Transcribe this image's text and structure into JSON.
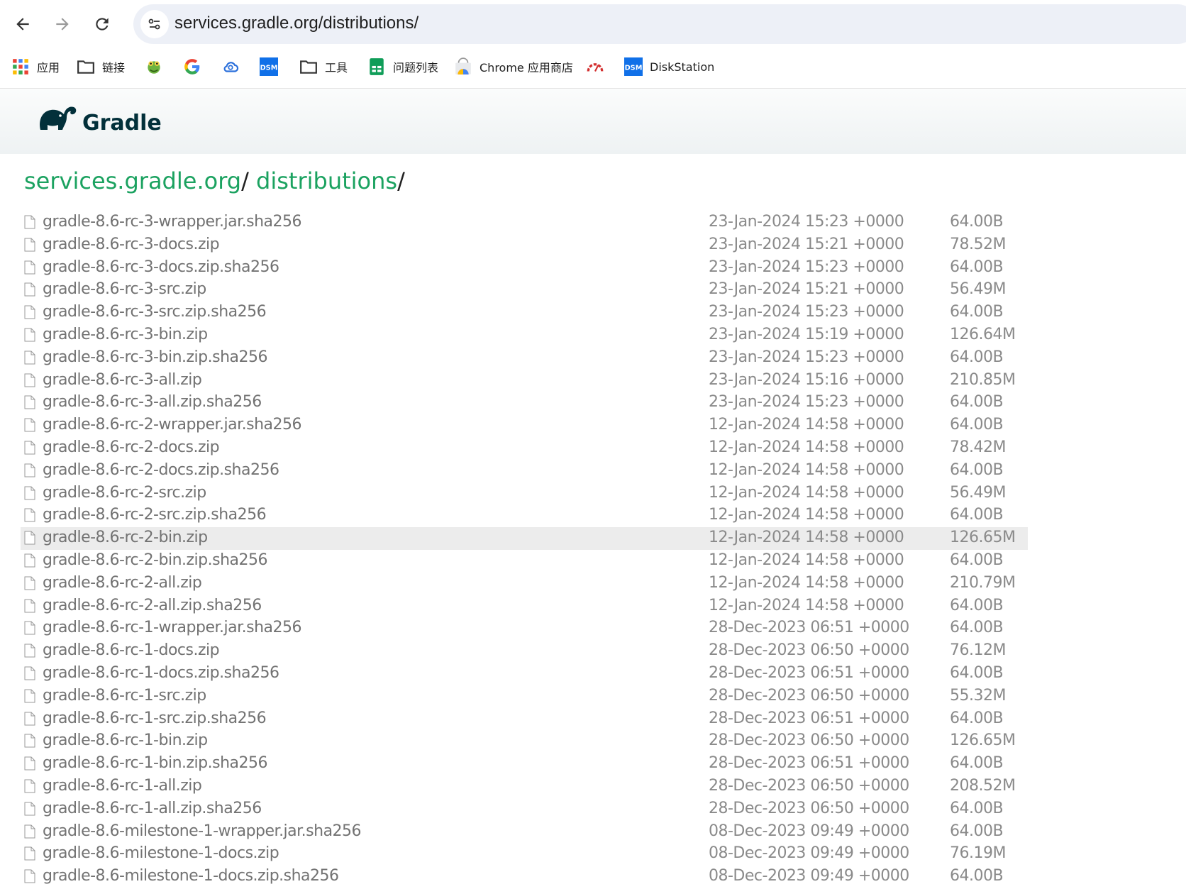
{
  "browser": {
    "url": "services.gradle.org/distributions/",
    "bookmarks": [
      {
        "label": "应用",
        "icon": "apps-grid-icon"
      },
      {
        "label": "链接",
        "icon": "folder-icon"
      },
      {
        "label": "",
        "icon": "frog-icon"
      },
      {
        "label": "",
        "icon": "google-icon"
      },
      {
        "label": "",
        "icon": "cloud-icon"
      },
      {
        "label": "",
        "icon": "dsm-icon"
      },
      {
        "label": "工具",
        "icon": "folder-icon"
      },
      {
        "label": "问题列表",
        "icon": "sheets-icon"
      },
      {
        "label": "Chrome 应用商店",
        "icon": "chrome-webstore-icon"
      },
      {
        "label": "",
        "icon": "speedometer-icon"
      },
      {
        "label": "DiskStation",
        "icon": "dsm-icon"
      }
    ]
  },
  "site": {
    "logo_text": "Gradle",
    "breadcrumb": [
      {
        "label": "services.gradle.org",
        "sep": "/"
      },
      {
        "label": "distributions",
        "sep": "/"
      }
    ]
  },
  "colors": {
    "accent": "#1ba260",
    "brand": "#02303a",
    "highlight_row": "#ececec"
  },
  "files": [
    {
      "name": "gradle-8.6-rc-3-wrapper.jar.sha256",
      "date": "23-Jan-2024 15:23 +0000",
      "size": "64.00B"
    },
    {
      "name": "gradle-8.6-rc-3-docs.zip",
      "date": "23-Jan-2024 15:21 +0000",
      "size": "78.52M"
    },
    {
      "name": "gradle-8.6-rc-3-docs.zip.sha256",
      "date": "23-Jan-2024 15:23 +0000",
      "size": "64.00B"
    },
    {
      "name": "gradle-8.6-rc-3-src.zip",
      "date": "23-Jan-2024 15:21 +0000",
      "size": "56.49M"
    },
    {
      "name": "gradle-8.6-rc-3-src.zip.sha256",
      "date": "23-Jan-2024 15:23 +0000",
      "size": "64.00B"
    },
    {
      "name": "gradle-8.6-rc-3-bin.zip",
      "date": "23-Jan-2024 15:19 +0000",
      "size": "126.64M"
    },
    {
      "name": "gradle-8.6-rc-3-bin.zip.sha256",
      "date": "23-Jan-2024 15:23 +0000",
      "size": "64.00B"
    },
    {
      "name": "gradle-8.6-rc-3-all.zip",
      "date": "23-Jan-2024 15:16 +0000",
      "size": "210.85M"
    },
    {
      "name": "gradle-8.6-rc-3-all.zip.sha256",
      "date": "23-Jan-2024 15:23 +0000",
      "size": "64.00B"
    },
    {
      "name": "gradle-8.6-rc-2-wrapper.jar.sha256",
      "date": "12-Jan-2024 14:58 +0000",
      "size": "64.00B"
    },
    {
      "name": "gradle-8.6-rc-2-docs.zip",
      "date": "12-Jan-2024 14:58 +0000",
      "size": "78.42M"
    },
    {
      "name": "gradle-8.6-rc-2-docs.zip.sha256",
      "date": "12-Jan-2024 14:58 +0000",
      "size": "64.00B"
    },
    {
      "name": "gradle-8.6-rc-2-src.zip",
      "date": "12-Jan-2024 14:58 +0000",
      "size": "56.49M"
    },
    {
      "name": "gradle-8.6-rc-2-src.zip.sha256",
      "date": "12-Jan-2024 14:58 +0000",
      "size": "64.00B"
    },
    {
      "name": "gradle-8.6-rc-2-bin.zip",
      "date": "12-Jan-2024 14:58 +0000",
      "size": "126.65M",
      "highlighted": true
    },
    {
      "name": "gradle-8.6-rc-2-bin.zip.sha256",
      "date": "12-Jan-2024 14:58 +0000",
      "size": "64.00B"
    },
    {
      "name": "gradle-8.6-rc-2-all.zip",
      "date": "12-Jan-2024 14:58 +0000",
      "size": "210.79M"
    },
    {
      "name": "gradle-8.6-rc-2-all.zip.sha256",
      "date": "12-Jan-2024 14:58 +0000",
      "size": "64.00B"
    },
    {
      "name": "gradle-8.6-rc-1-wrapper.jar.sha256",
      "date": "28-Dec-2023 06:51 +0000",
      "size": "64.00B"
    },
    {
      "name": "gradle-8.6-rc-1-docs.zip",
      "date": "28-Dec-2023 06:50 +0000",
      "size": "76.12M"
    },
    {
      "name": "gradle-8.6-rc-1-docs.zip.sha256",
      "date": "28-Dec-2023 06:51 +0000",
      "size": "64.00B"
    },
    {
      "name": "gradle-8.6-rc-1-src.zip",
      "date": "28-Dec-2023 06:50 +0000",
      "size": "55.32M"
    },
    {
      "name": "gradle-8.6-rc-1-src.zip.sha256",
      "date": "28-Dec-2023 06:51 +0000",
      "size": "64.00B"
    },
    {
      "name": "gradle-8.6-rc-1-bin.zip",
      "date": "28-Dec-2023 06:50 +0000",
      "size": "126.65M"
    },
    {
      "name": "gradle-8.6-rc-1-bin.zip.sha256",
      "date": "28-Dec-2023 06:51 +0000",
      "size": "64.00B"
    },
    {
      "name": "gradle-8.6-rc-1-all.zip",
      "date": "28-Dec-2023 06:50 +0000",
      "size": "208.52M"
    },
    {
      "name": "gradle-8.6-rc-1-all.zip.sha256",
      "date": "28-Dec-2023 06:50 +0000",
      "size": "64.00B"
    },
    {
      "name": "gradle-8.6-milestone-1-wrapper.jar.sha256",
      "date": "08-Dec-2023 09:49 +0000",
      "size": "64.00B"
    },
    {
      "name": "gradle-8.6-milestone-1-docs.zip",
      "date": "08-Dec-2023 09:49 +0000",
      "size": "76.19M"
    },
    {
      "name": "gradle-8.6-milestone-1-docs.zip.sha256",
      "date": "08-Dec-2023 09:49 +0000",
      "size": "64.00B"
    }
  ]
}
